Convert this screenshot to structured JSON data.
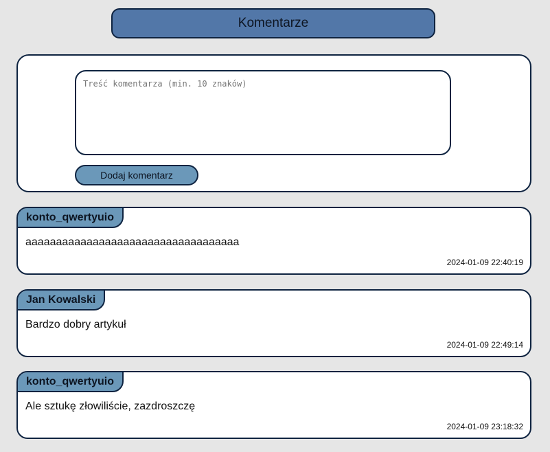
{
  "header": {
    "title": "Komentarze"
  },
  "form": {
    "placeholder": "Treść komentarza (min. 10 znaków)",
    "value": "",
    "submit_label": "Dodaj komentarz"
  },
  "comments": [
    {
      "author": "konto_qwertyuio",
      "text": "aaaaaaaaaaaaaaaaaaaaaaaaaaaaaaaaaaa",
      "date": "2024-01-09 22:40:19"
    },
    {
      "author": "Jan Kowalski",
      "text": "Bardzo dobry artykuł",
      "date": "2024-01-09 22:49:14"
    },
    {
      "author": "konto_qwertyuio",
      "text": "Ale sztukę złowiliście, zazdroszczę",
      "date": "2024-01-09 23:18:32"
    }
  ],
  "colors": {
    "page_background": "#e6e6e6",
    "header_background": "#5277a8",
    "accent": "#6b98b9",
    "border": "#0e2340",
    "card_background": "#ffffff"
  }
}
